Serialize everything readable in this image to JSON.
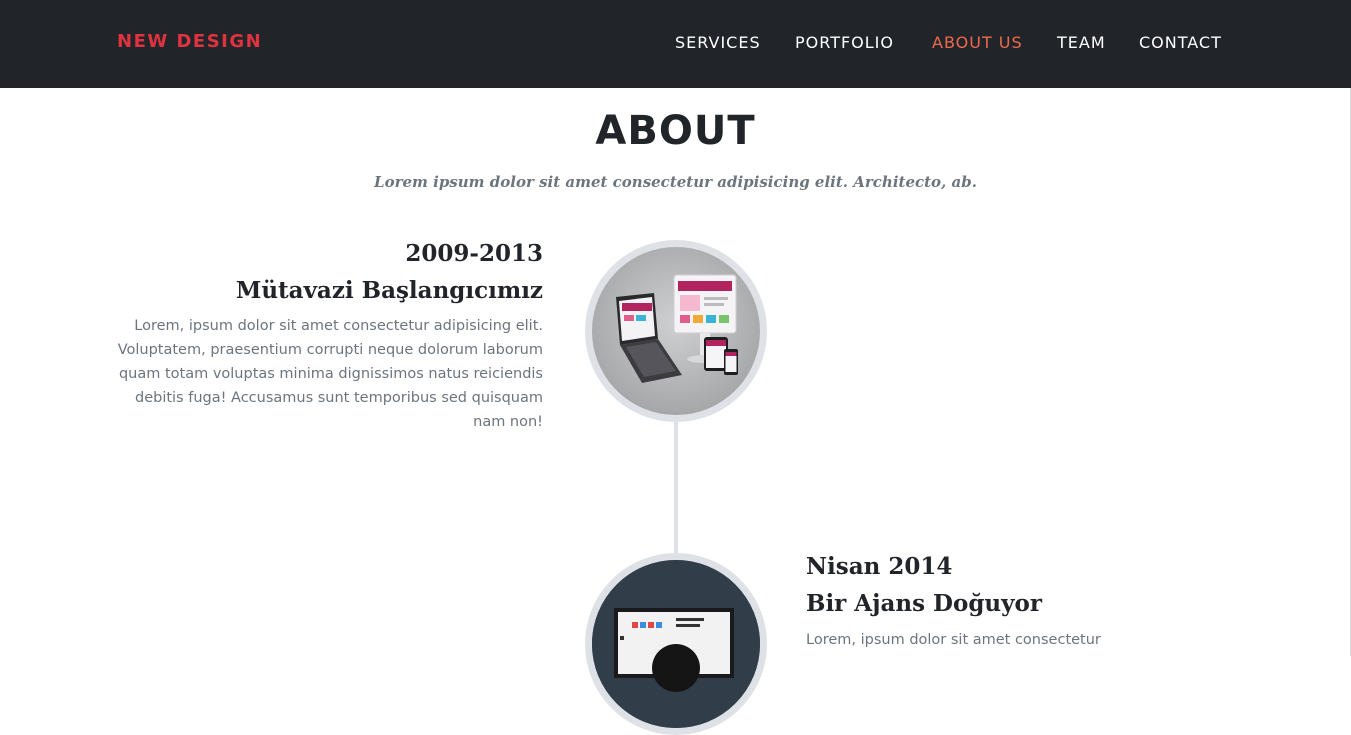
{
  "navbar": {
    "brand": "NEW DESIGN",
    "items": [
      {
        "label": "SERVICES"
      },
      {
        "label": "PORTFOLIO"
      },
      {
        "label": "ABOUT US"
      },
      {
        "label": "TEAM"
      },
      {
        "label": "CONTACT"
      }
    ],
    "active": "ABOUT US",
    "colors": {
      "background": "#212529",
      "brand": "#e0323f",
      "active": "#f0694e"
    }
  },
  "about": {
    "title": "ABOUT",
    "subtitle": "Lorem ipsum dolor sit amet consectetur adipisicing elit. Architecto, ab.",
    "timeline": [
      {
        "date": "2009-2013",
        "title": "Mütavazi Başlangıcımız",
        "body": "Lorem, ipsum dolor sit amet consectetur adipisicing elit. Voluptatem, praesentium corrupti neque dolorum laborum quam totam voluptas minima dignissimos natus reiciendis debitis fuga! Accusamus sunt temporibus sed quisquam nam non!",
        "image_icon": "devices-mockup-image"
      },
      {
        "date": "Nisan 2014",
        "title": "Bir Ajans Doğuyor",
        "body": "Lorem, ipsum dolor sit amet consectetur",
        "image_icon": "workstation-photo-image"
      }
    ]
  }
}
